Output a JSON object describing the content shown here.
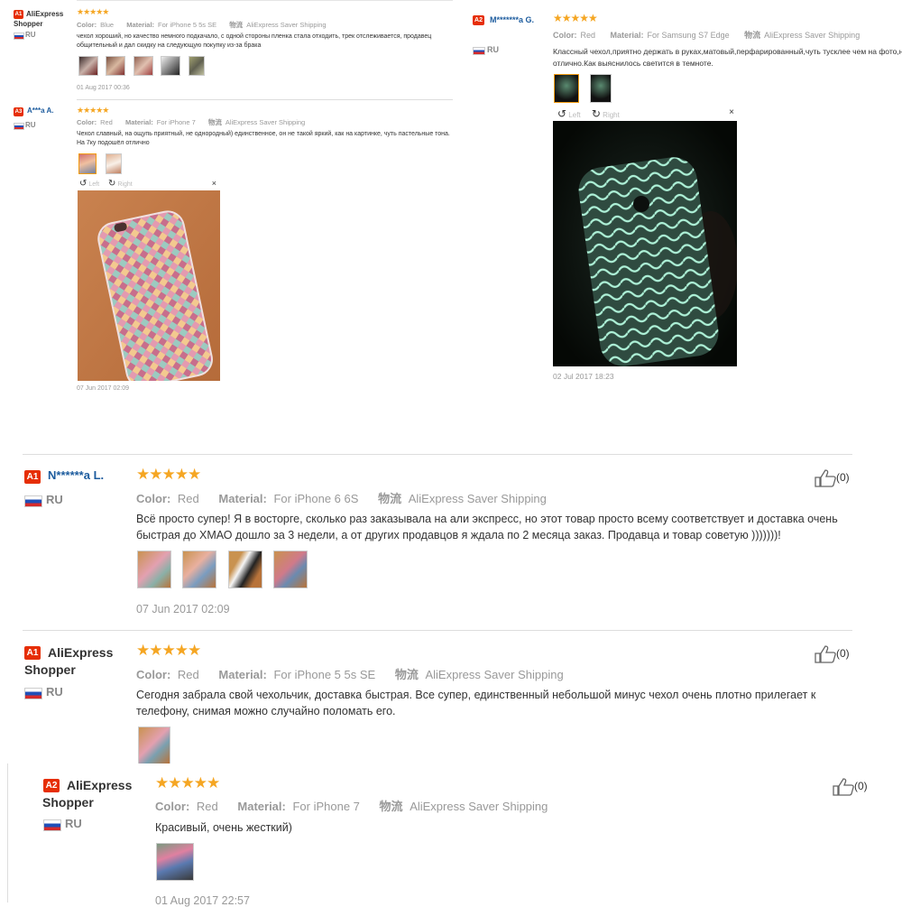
{
  "top_left_1": {
    "badge": "A1",
    "user": "AliExpress Shopper",
    "country": "RU",
    "stars": "★★★★★",
    "color_label": "Color:",
    "color_value": "Blue",
    "material_label": "Material:",
    "material_value": "For iPhone 5 5s SE",
    "shipping_label": "物流",
    "shipping_value": "AliExpress Saver Shipping",
    "text": "чехол хороший, но качество немного подкачало, с одной стороны пленка стала отходить, трек отслеживается, продавец общительный и дал скидку на следующую покупку из-за брака",
    "date": "01 Aug 2017 00:36"
  },
  "top_left_2": {
    "badge": "A3",
    "user": "A***a A.",
    "country": "RU",
    "stars": "★★★★★",
    "color_label": "Color:",
    "color_value": "Red",
    "material_label": "Material:",
    "material_value": "For iPhone 7",
    "shipping_label": "物流",
    "shipping_value": "AliExpress Saver Shipping",
    "text": "Чехол славный, на ощупь приятный, не однородный) единственное, он не такой яркий, как на картинке, чуть пастельные тона. На 7ку подошёл отлично",
    "viewer_left": "Left",
    "viewer_right": "Right",
    "viewer_close": "×",
    "date": "07 Jun 2017 02:09"
  },
  "top_right": {
    "badge": "A2",
    "user": "M*******a G.",
    "country": "RU",
    "stars": "★★★★★",
    "color_label": "Color:",
    "color_value": "Red",
    "material_label": "Material:",
    "material_value": "For Samsung S7 Edge",
    "shipping_label": "物流",
    "shipping_value": "AliExpress Saver Shipping",
    "text": "Классный чехол,приятно держать в руках,матовый,перфарированный,чуть тусклее чем на фото,но отлично.Как выяснилось светится в темноте.",
    "viewer_left": "Left",
    "viewer_right": "Right",
    "viewer_close": "×",
    "date": "02 Jul 2017 18:23"
  },
  "review_1": {
    "badge": "A1",
    "user": "N******a L.",
    "country": "RU",
    "stars": "★★★★★",
    "color_label": "Color:",
    "color_value": "Red",
    "material_label": "Material:",
    "material_value": "For iPhone 6 6S",
    "shipping_label": "物流",
    "shipping_value": "AliExpress Saver Shipping",
    "text": "Всё просто супер! Я в восторге, сколько раз заказывала на али экспресс, но этот товар просто всему соответствует и доставка очень быстрая до ХМАО дошло за 3 недели, а от других продавцов я ждала по 2 месяца заказ. Продавца и товар советую )))))))!",
    "date": "07 Jun 2017 02:09",
    "helpful": "(0)"
  },
  "review_2": {
    "badge": "A1",
    "user": "AliExpress Shopper",
    "country": "RU",
    "stars": "★★★★★",
    "color_label": "Color:",
    "color_value": "Red",
    "material_label": "Material:",
    "material_value": "For iPhone 5 5s SE",
    "shipping_label": "物流",
    "shipping_value": "AliExpress Saver Shipping",
    "text": "Сегодня забрала свой чехольчик, доставка быстрая. Все супер, единственный небольшой минус чехол очень плотно прилегает к телефону, снимая можно случайно поломать его.",
    "helpful": "(0)"
  },
  "review_3": {
    "badge": "A2",
    "user": "AliExpress Shopper",
    "country": "RU",
    "stars": "★★★★★",
    "color_label": "Color:",
    "color_value": "Red",
    "material_label": "Material:",
    "material_value": "For iPhone 7",
    "shipping_label": "物流",
    "shipping_value": "AliExpress Saver Shipping",
    "text": "Красивый, очень жесткий)",
    "date": "01 Aug 2017 22:57",
    "helpful": "(0)"
  },
  "colors": {
    "badge": "#e62e04",
    "star": "#f5a623",
    "link_blue": "#1d5c9e",
    "selected_border": "#f39c12"
  }
}
